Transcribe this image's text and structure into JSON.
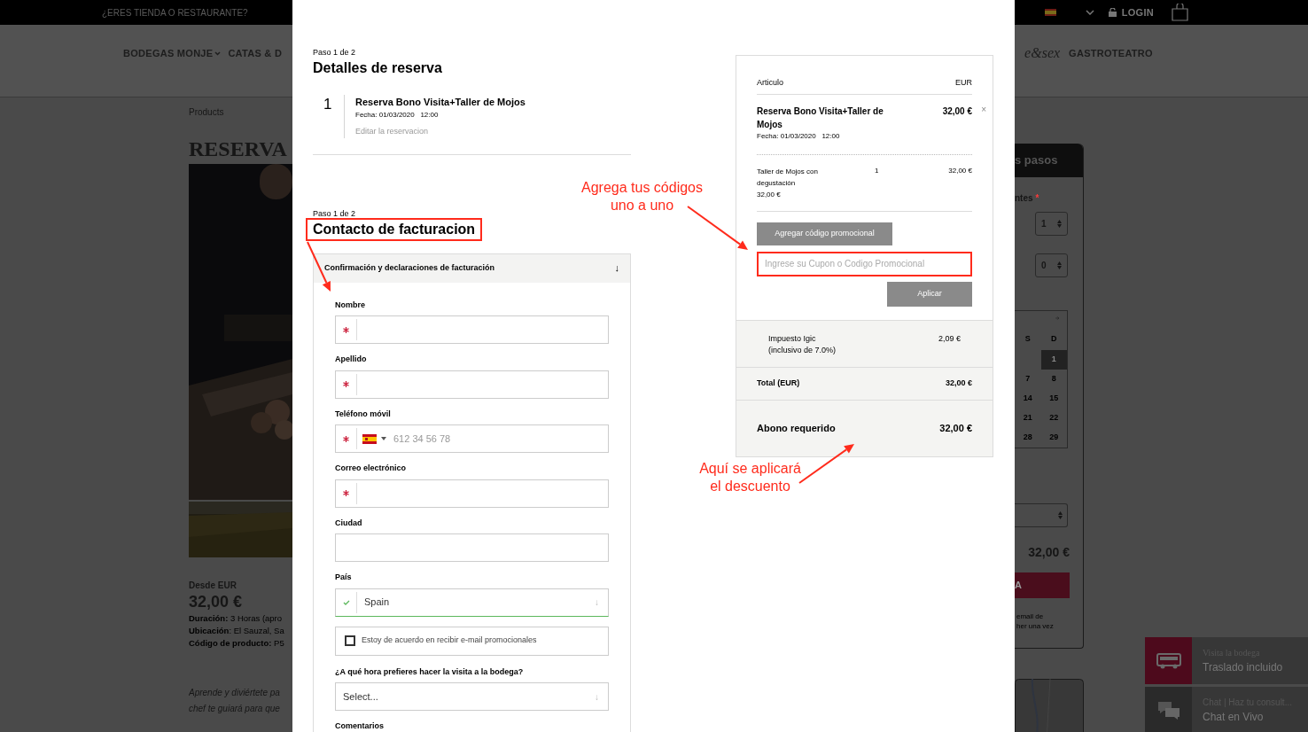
{
  "background_page": {
    "top_bar": {
      "link": "¿ERES TIENDA O RESTAURANTE?",
      "login": "LOGIN"
    },
    "nav": {
      "items": [
        "BODEGAS MONJE",
        "CATAS & D"
      ],
      "logo_fragment": "e&sex",
      "right_item": "GASTROTEATRO"
    },
    "breadcrumb": "Products",
    "product_title": "RESERVA",
    "price_label": "Desde EUR",
    "price": "32,00 €",
    "details": [
      "**Duración:** 3 Horas (apro",
      "**Ubicación**: El Sauzal, Sa",
      "**Código de producto:** P5"
    ],
    "description": [
      "Aprende y diviértete pa",
      "chef te guiará para que"
    ],
    "booking_widget": {
      "title": "s pasos",
      "participants_label": "ntes",
      "required_mark": "*",
      "selects": [
        "1",
        "0"
      ],
      "weekdays": [
        "S",
        "D"
      ],
      "days": [
        {
          "label": "1",
          "selected": true
        },
        {
          "label": "7",
          "selected": false
        },
        {
          "label": "8",
          "selected": false
        },
        {
          "label": "14",
          "selected": false
        },
        {
          "label": "15",
          "selected": false
        },
        {
          "label": "21",
          "selected": false
        },
        {
          "label": "22",
          "selected": false
        },
        {
          "label": "28",
          "selected": false
        },
        {
          "label": "29",
          "selected": false
        }
      ],
      "total": "32,00 €",
      "button": "A",
      "note": [
        "email de",
        "her una vez"
      ]
    },
    "floating": [
      {
        "kind": "transfer",
        "title": "Visita la bodega",
        "subtitle": "Traslado incluido"
      },
      {
        "kind": "chat",
        "title": "Chat | Haz tu consult...",
        "subtitle": "Chat en Vivo"
      }
    ]
  },
  "modal": {
    "booking_step": {
      "step": "Paso 1 de 2",
      "title": "Detalles de reserva",
      "item": {
        "number": "1",
        "name": "Reserva Bono Visita+Taller de Mojos",
        "date": "Fecha: 01/03/2020   12:00",
        "edit_link": "Editar la reservacion"
      }
    },
    "billing_step": {
      "step": "Paso 1 de 2",
      "title": "Contacto de facturacion",
      "section": {
        "title": "Confirmación y declaraciones de facturación",
        "arrow": "↓"
      },
      "fields": [
        {
          "kind": "text",
          "label": "Nombre",
          "required": true
        },
        {
          "kind": "text",
          "label": "Apellido",
          "required": true
        },
        {
          "kind": "phone",
          "label": "Teléfono móvil",
          "required": true,
          "placeholder": "612 34 56 78"
        },
        {
          "kind": "text",
          "label": "Correo electrónico",
          "required": true
        },
        {
          "kind": "text",
          "label": "Ciudad",
          "required": false
        },
        {
          "kind": "select",
          "label": "País",
          "valid": true,
          "value": "Spain",
          "arrow": "↓"
        },
        {
          "kind": "checkbox",
          "text": "Estoy de acuerdo en recibir e-mail promocionales",
          "checked": false
        },
        {
          "kind": "select",
          "label": "¿A qué hora prefieres hacer la visita a la bodega?",
          "valid": false,
          "value": "Select...",
          "arrow": "↓"
        },
        {
          "kind": "label",
          "label": "Comentarios"
        }
      ]
    },
    "summary": {
      "columns": [
        "Articulo",
        "EUR"
      ],
      "item": {
        "name": "Reserva Bono Visita+Taller de Mojos",
        "price": "32,00 €",
        "remove": "×",
        "date": "Fecha: 01/03/2020   12:00",
        "line": {
          "name": "Taller de Mojos con degustación",
          "quantity": "1",
          "amount": "32,00 €",
          "unit_price": "32,00 €"
        }
      },
      "promo_button": "Agregar código promocional",
      "coupon_placeholder": "Ingrese su Cupon o Codigo Promocional",
      "apply_button": "Aplicar",
      "tax": {
        "label": "Impuesto Igic",
        "note": "(inclusivo de 7.0%)",
        "amount": "2,09 €"
      },
      "total": {
        "label": "Total (EUR)",
        "amount": "32,00 €"
      },
      "deposit": {
        "label": "Abono requerido",
        "amount": "32,00 €"
      }
    },
    "annotations": [
      {
        "lines": [
          "Agrega tus códigos",
          "uno a uno"
        ]
      },
      {
        "lines": [
          "Aquí se aplicará",
          "el descuento"
        ]
      }
    ]
  }
}
